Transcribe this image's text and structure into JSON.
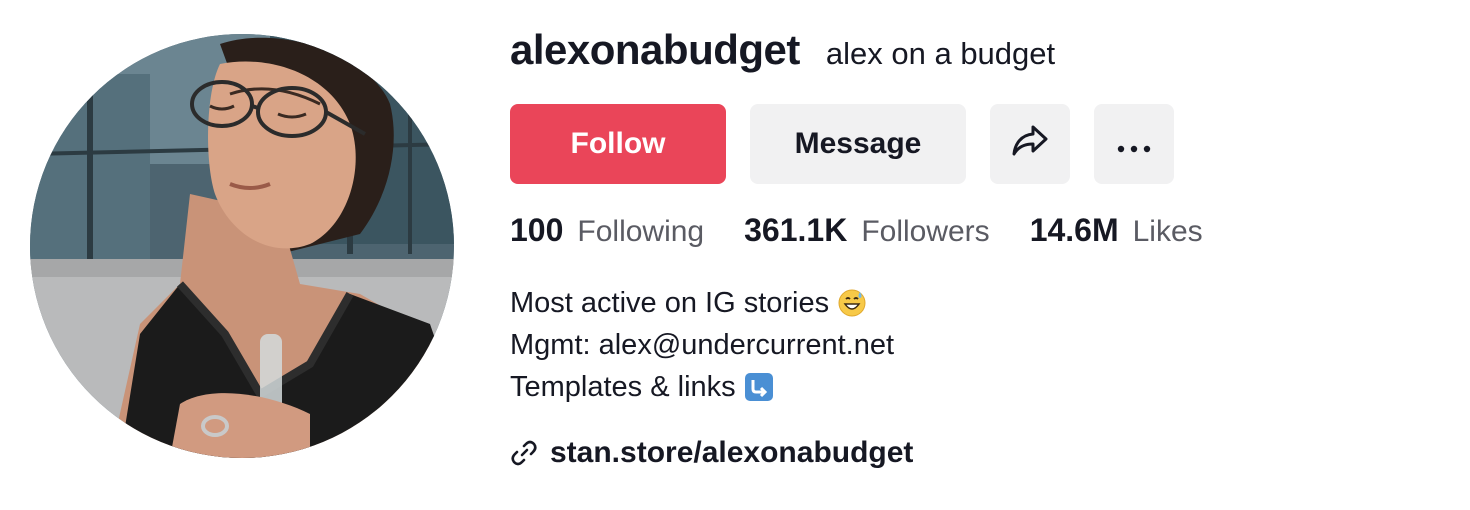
{
  "profile": {
    "username": "alexonabudget",
    "nickname": "alex on a budget",
    "avatar_icon": "profile-photo"
  },
  "actions": {
    "follow_label": "Follow",
    "message_label": "Message",
    "share_icon": "share-arrow-icon",
    "more_label": "···"
  },
  "stats": {
    "following_count": "100",
    "following_label": "Following",
    "followers_count": "361.1K",
    "followers_label": "Followers",
    "likes_count": "14.6M",
    "likes_label": "Likes"
  },
  "bio": {
    "line1": "Most active on IG stories",
    "line1_emoji": "grinning-sweat-emoji",
    "line2": "Mgmt: alex@undercurrent.net",
    "line3": "Templates & links",
    "line3_emoji": "arrow-down-right-emoji"
  },
  "link": {
    "text": "stan.store/alexonabudget",
    "icon": "link-icon"
  },
  "colors": {
    "follow_bg": "#ea4559",
    "button_bg": "#f1f1f2",
    "text_primary": "#161823",
    "text_secondary": "#5a5b63"
  }
}
